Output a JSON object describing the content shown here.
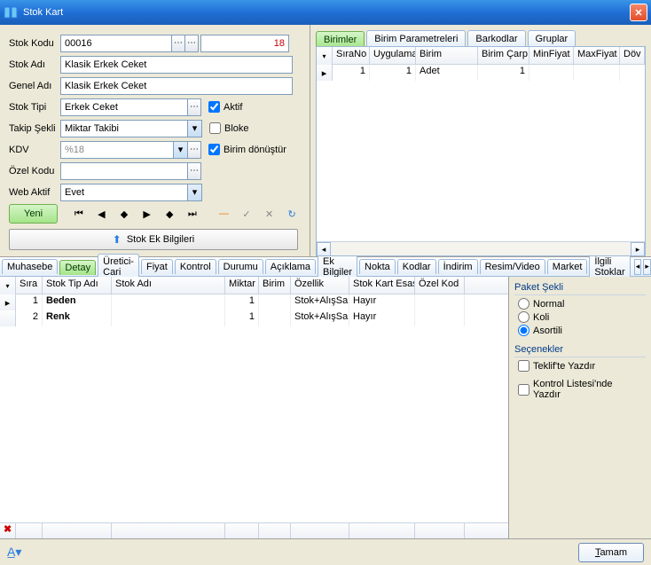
{
  "window": {
    "title": "Stok Kart"
  },
  "form": {
    "stokKoduLabel": "Stok Kodu",
    "stokKodu": "00016",
    "stokKoduSeq": "18",
    "stokAdiLabel": "Stok Adı",
    "stokAdi": "Klasik Erkek Ceket",
    "genelAdiLabel": "Genel Adı",
    "genelAdi": "Klasik Erkek Ceket",
    "stokTipiLabel": "Stok Tipi",
    "stokTipi": "Erkek Ceket",
    "takipSekliLabel": "Takip Şekli",
    "takipSekli": "Miktar Takibi",
    "kdvLabel": "KDV",
    "kdv": "%18",
    "ozelKoduLabel": "Özel Kodu",
    "ozelKodu": "",
    "webAktifLabel": "Web Aktif",
    "webAktif": "Evet",
    "aktifLabel": "Aktif",
    "blokeLabel": "Bloke",
    "birimDonLabel": "Birim dönüştür",
    "yeniLabel": "Yeni",
    "stokEkLabel": "Stok Ek Bilgileri"
  },
  "unitTabs": {
    "birimler": "Birimler",
    "birimParam": "Birim Parametreleri",
    "barkodlar": "Barkodlar",
    "gruplar": "Gruplar"
  },
  "unitGrid": {
    "headers": {
      "siraNo": "SıraNo",
      "uygulama": "Uygulama",
      "birim": "Birim",
      "birimCarp": "Birim Çarp",
      "minFiyat": "MinFiyat",
      "maxFiyat": "MaxFiyat",
      "dov": "Döv"
    },
    "row": {
      "siraNo": "1",
      "uygulama": "1",
      "birim": "Adet",
      "birimCarp": "1",
      "minFiyat": "",
      "maxFiyat": ""
    }
  },
  "lowerTabs": [
    "Muhasebe",
    "Detay",
    "Üretici-Cari",
    "Fiyat",
    "Kontrol",
    "Durumu",
    "Açıklama",
    "Ek Bilgiler",
    "Nokta",
    "Kodlar",
    "İndirim",
    "Resim/Video",
    "Market",
    "İlgili Stoklar"
  ],
  "detailGrid": {
    "headers": {
      "sira": "Sıra",
      "stokTipAdi": "Stok Tip Adı",
      "stokAdi": "Stok Adı",
      "miktar": "Miktar",
      "birim": "Birim",
      "ozellik": "Özellik",
      "stokKartEsasli": "Stok Kart Esaslı",
      "ozelKod": "Özel Kod"
    },
    "rows": [
      {
        "sira": "1",
        "stokTipAdi": "Beden",
        "stokAdi": "",
        "miktar": "1",
        "birim": "",
        "ozellik": "Stok+AlışSa",
        "esasli": "Hayır",
        "ozelKod": ""
      },
      {
        "sira": "2",
        "stokTipAdi": "Renk",
        "stokAdi": "",
        "miktar": "1",
        "birim": "",
        "ozellik": "Stok+AlışSa",
        "esasli": "Hayır",
        "ozelKod": ""
      }
    ]
  },
  "sideOpts": {
    "paketSekliLabel": "Paket Şekli",
    "normal": "Normal",
    "koli": "Koli",
    "asortili": "Asortili",
    "seceneklerLabel": "Seçenekler",
    "teklifteYazdir": "Teklif'te Yazdır",
    "kontrolListesindeYazdir": "Kontrol Listesi'nde Yazdır"
  },
  "bottom": {
    "tamam": "Tamam"
  }
}
